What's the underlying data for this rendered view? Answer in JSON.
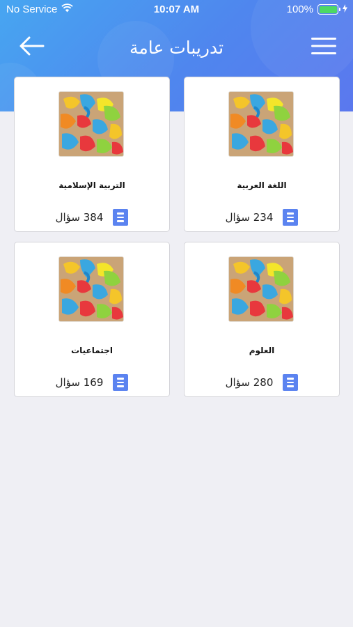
{
  "status_bar": {
    "carrier": "No Service",
    "time": "10:07 AM",
    "battery": "100%",
    "icons": [
      "wifi-icon",
      "battery-icon",
      "charging-bolt-icon"
    ]
  },
  "header": {
    "title": "تدريبات عامة",
    "back_icon": "arrow-left-icon",
    "menu_icon": "hamburger-menu-icon"
  },
  "colors": {
    "header_start": "#47a6f1",
    "header_end": "#5b78ee",
    "background": "#efeff4",
    "doc_icon": "#5b83f0",
    "battery_fill": "#4cd964"
  },
  "cards": [
    {
      "title": "التربية الإسلامية",
      "count": "384 سؤال",
      "icon": "document-list-icon"
    },
    {
      "title": "اللغة العربية",
      "count": "234 سؤال",
      "icon": "document-list-icon"
    },
    {
      "title": "اجتماعيات",
      "count": "169 سؤال",
      "icon": "document-list-icon"
    },
    {
      "title": "العلوم",
      "count": "280 سؤال",
      "icon": "document-list-icon"
    }
  ]
}
